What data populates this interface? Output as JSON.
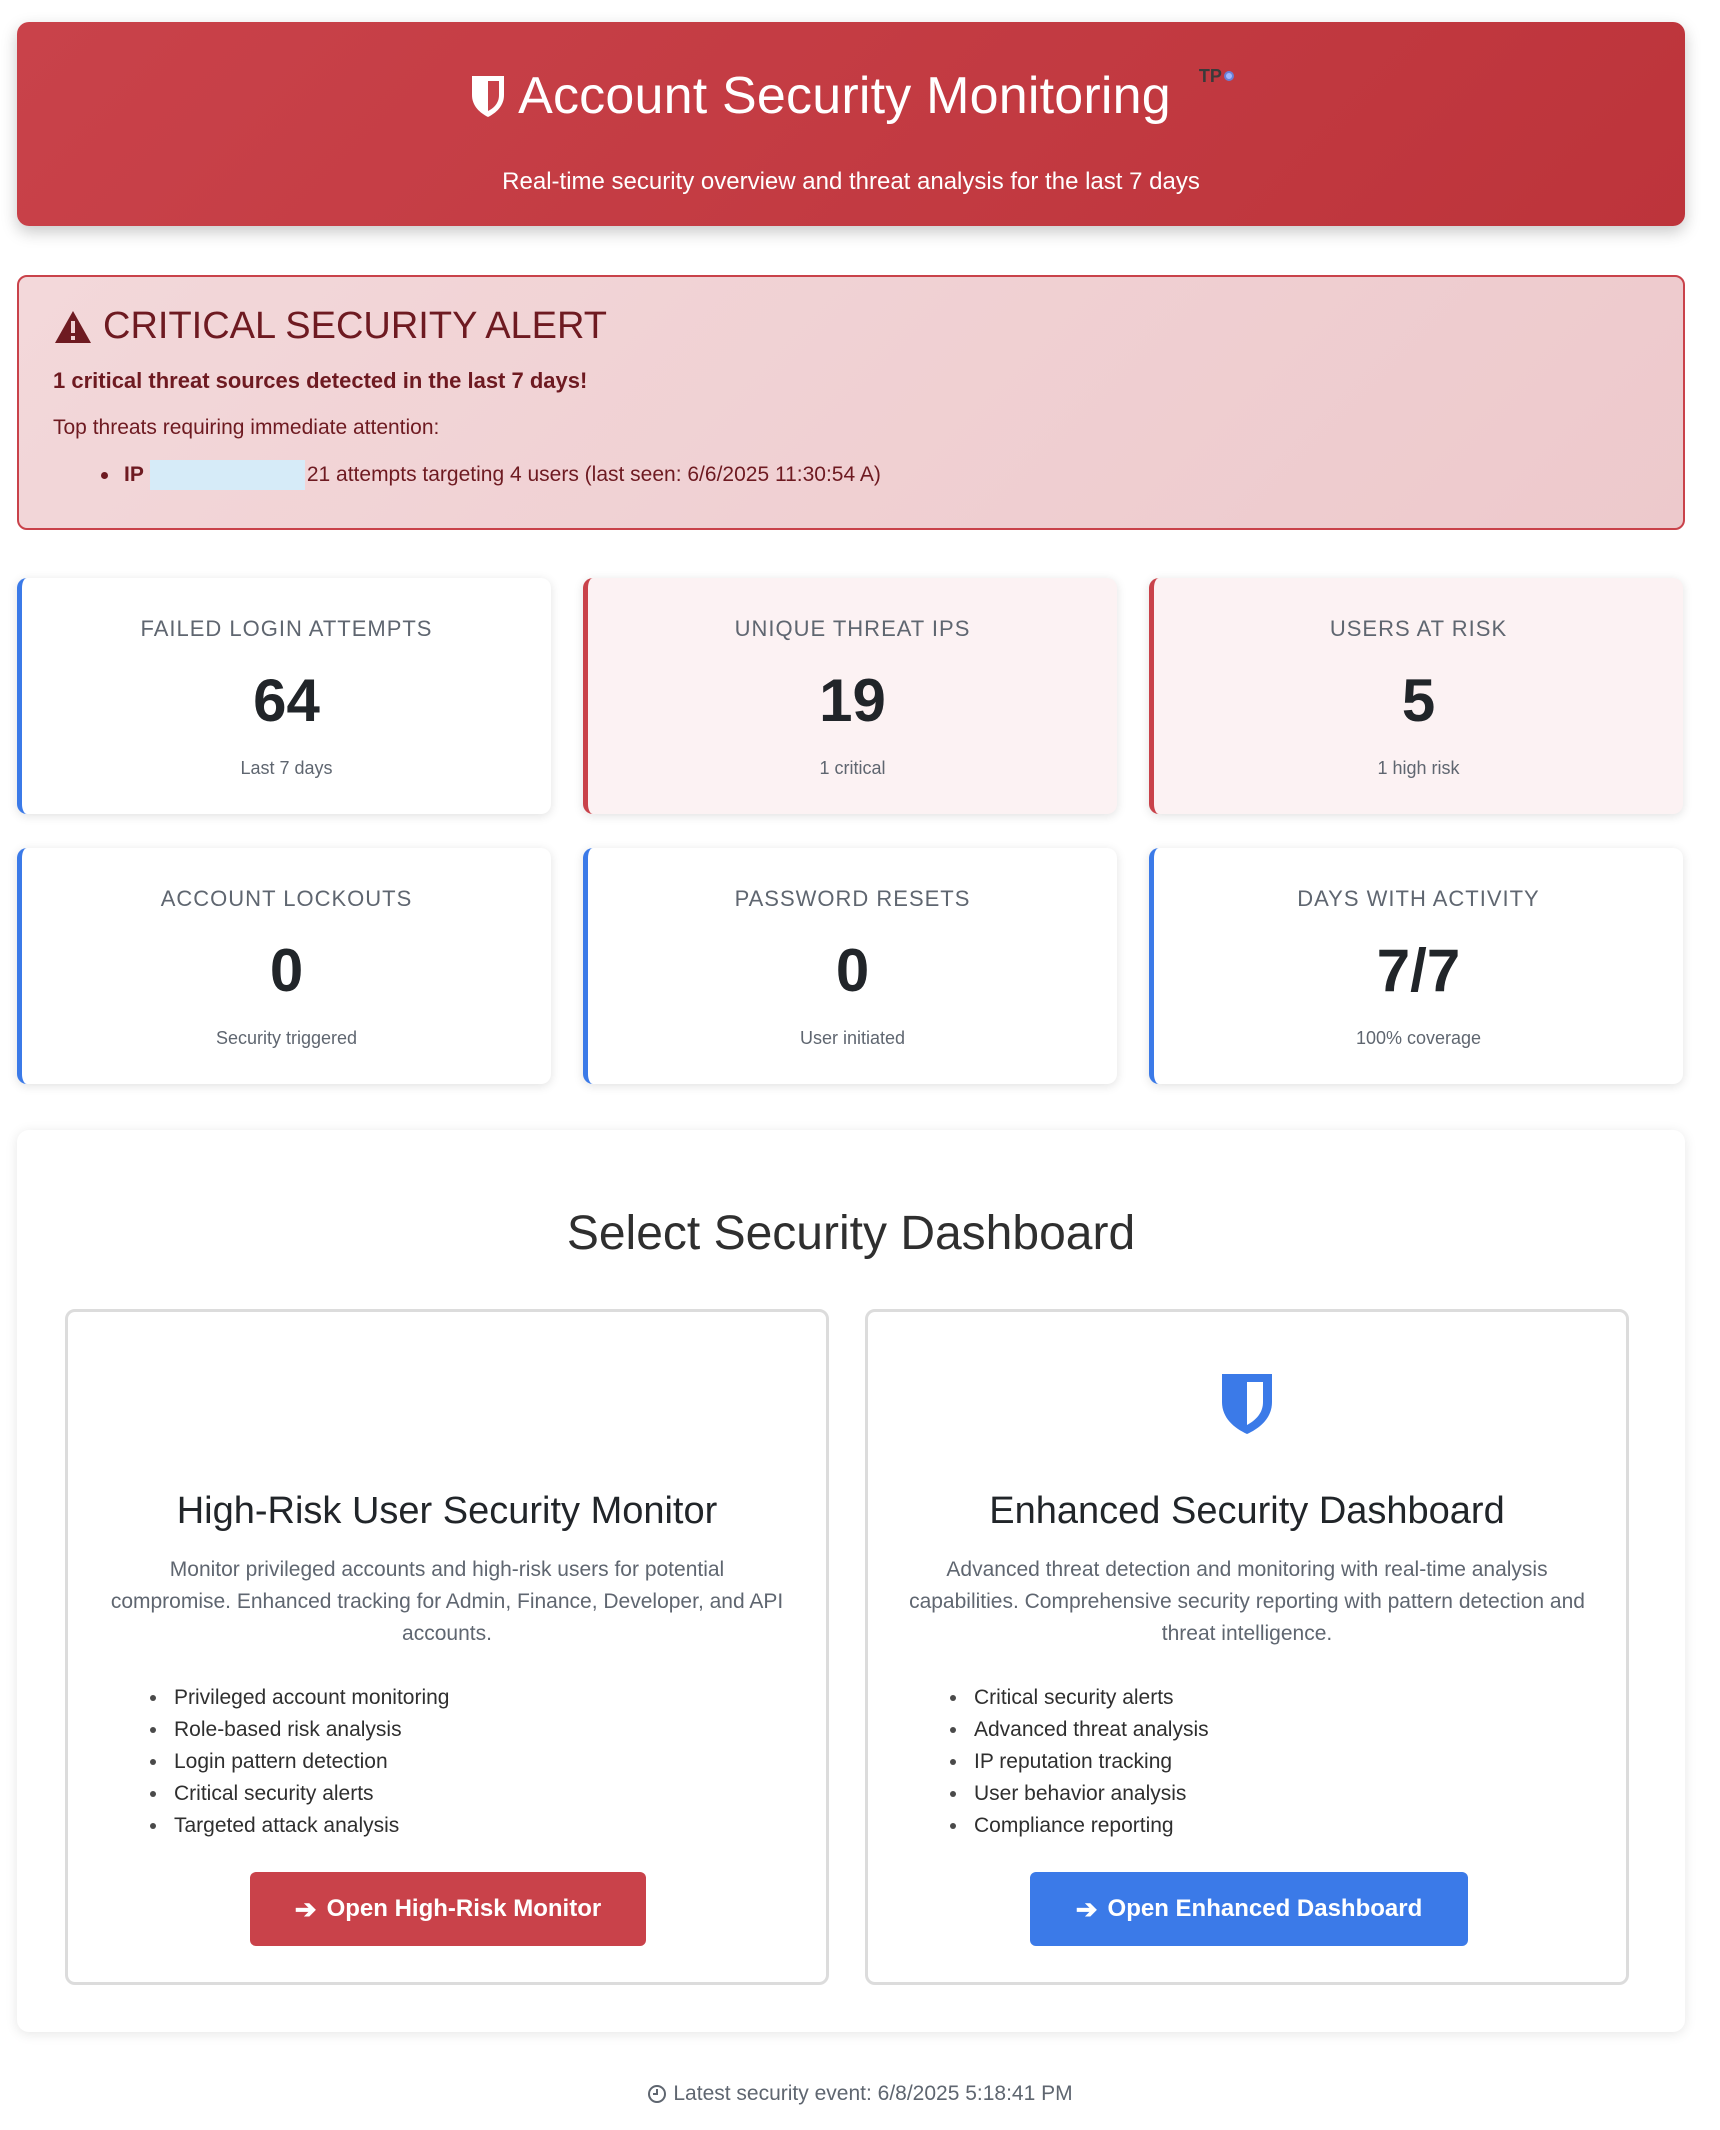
{
  "header": {
    "title": "Account Security Monitoring",
    "badge": "TP",
    "subtitle": "Real-time security overview and threat analysis for the last 7 days"
  },
  "alert": {
    "title": "CRITICAL SECURITY ALERT",
    "summary": "1 critical threat sources detected in the last 7 days!",
    "intro": "Top threats requiring immediate attention:",
    "threats": [
      {
        "ip_label": "IP",
        "detail": "21 attempts targeting 4 users (last seen: 6/6/2025 11:30:54 A)"
      }
    ]
  },
  "stats": [
    {
      "label": "FAILED LOGIN ATTEMPTS",
      "value": "64",
      "sub": "Last 7 days"
    },
    {
      "label": "UNIQUE THREAT IPS",
      "value": "19",
      "sub": "1 critical"
    },
    {
      "label": "USERS AT RISK",
      "value": "5",
      "sub": "1 high risk"
    },
    {
      "label": "ACCOUNT LOCKOUTS",
      "value": "0",
      "sub": "Security triggered"
    },
    {
      "label": "PASSWORD RESETS",
      "value": "0",
      "sub": "User initiated"
    },
    {
      "label": "DAYS WITH ACTIVITY",
      "value": "7/7",
      "sub": "100% coverage"
    }
  ],
  "select": {
    "title": "Select Security Dashboard",
    "options": [
      {
        "title": "High-Risk User Security Monitor",
        "description": "Monitor privileged accounts and high-risk users for potential compromise. Enhanced tracking for Admin, Finance, Developer, and API accounts.",
        "features": [
          "Privileged account monitoring",
          "Role-based risk analysis",
          "Login pattern detection",
          "Critical security alerts",
          "Targeted attack analysis"
        ],
        "button": "Open High-Risk Monitor"
      },
      {
        "title": "Enhanced Security Dashboard",
        "description": "Advanced threat detection and monitoring with real-time analysis capabilities. Comprehensive security reporting with pattern detection and threat intelligence.",
        "features": [
          "Critical security alerts",
          "Advanced threat analysis",
          "IP reputation tracking",
          "User behavior analysis",
          "Compliance reporting"
        ],
        "button": "Open Enhanced Dashboard"
      }
    ]
  },
  "footer": {
    "latest_event": "Latest security event: 6/8/2025 5:18:41 PM"
  },
  "colors": {
    "danger": "#c9424a",
    "primary": "#3b7ae8"
  },
  "icons": {
    "header": "shield-icon",
    "alert": "warning-triangle-icon",
    "option_enhanced": "shield-icon",
    "button": "arrow-right-icon",
    "footer": "clock-icon"
  }
}
